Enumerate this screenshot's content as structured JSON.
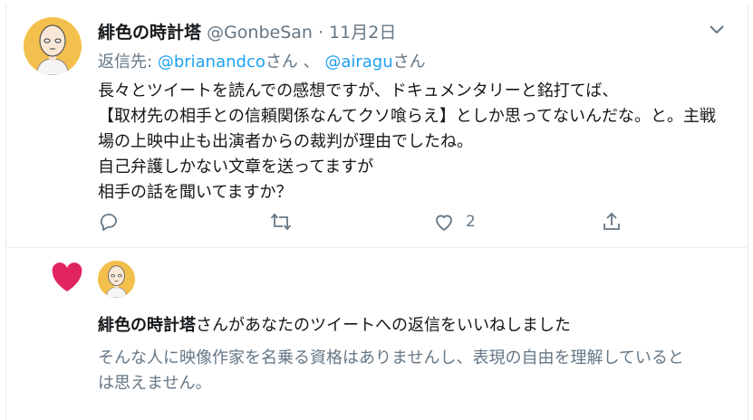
{
  "tweet": {
    "display_name": "緋色の時計塔",
    "handle": "@GonbeSan",
    "separator": "·",
    "date": "11月2日",
    "reply_prefix": "返信先:",
    "reply_user_1": "@brianandco",
    "reply_suffix_1": "さん 、",
    "reply_user_2": "@airagu",
    "reply_suffix_2": "さん",
    "body": "長々とツイートを読んでの感想ですが、ドキュメンタリーと銘打てば、\n【取材先の相手との信頼関係なんてクソ喰らえ】としか思ってないんだな。と。主戦場の上映中止も出演者からの裁判が理由でしたね。\n自己弁護しかない文章を送ってますが\n相手の話を聞いてますか？",
    "actions": {
      "reply_icon": "reply-icon",
      "retweet_icon": "retweet-icon",
      "like_icon": "heart-outline-icon",
      "like_count": "2",
      "share_icon": "share-icon"
    }
  },
  "notification": {
    "icon": "heart-filled-icon",
    "icon_color": "#e0245e",
    "name": "緋色の時計塔",
    "text": "さんがあなたのツイートへの返信をいいねしました",
    "quoted_reply": "そんな人に映像作家を名乗る資格はありませんし、表現の自由を理解しているとは思えません。"
  },
  "colors": {
    "link": "#1da1f2",
    "secondary_text": "#657786",
    "primary_text": "#14171a",
    "border": "#e6ecf0"
  }
}
